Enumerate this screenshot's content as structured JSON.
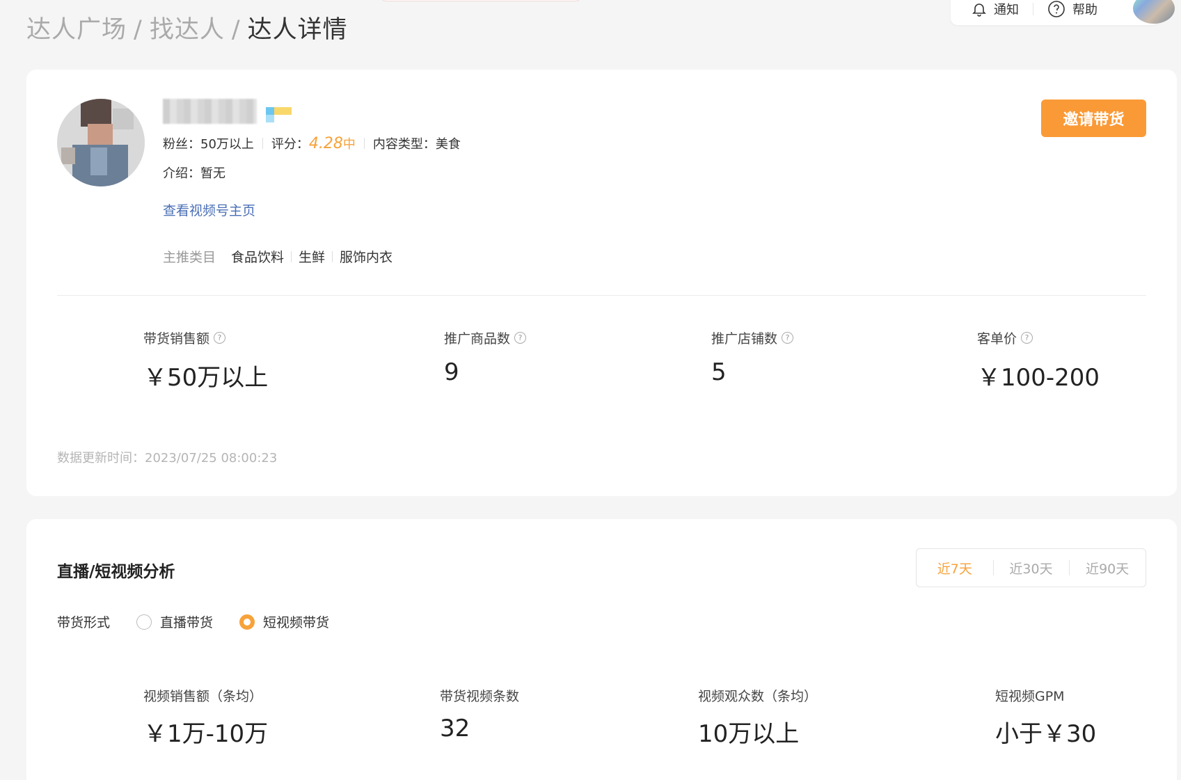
{
  "breadcrumb": {
    "items": [
      "达人广场",
      "找达人"
    ],
    "separator": "/",
    "current": "达人详情"
  },
  "top_tools": {
    "notify_label": "通知",
    "help_label": "帮助"
  },
  "profile": {
    "fans_label": "粉丝：",
    "fans_value": "50万以上",
    "score_label": "评分：",
    "score_value": "4.28",
    "score_level": "中",
    "content_type_label": "内容类型：",
    "content_type_value": "美食",
    "intro_label": "介绍：",
    "intro_value": "暂无",
    "homepage_link": "查看视频号主页",
    "category_label": "主推类目",
    "categories": [
      "食品饮料",
      "生鲜",
      "服饰内衣"
    ],
    "invite_button": "邀请带货"
  },
  "stats": [
    {
      "label": "带货销售额",
      "value": "￥50万以上"
    },
    {
      "label": "推广商品数",
      "value": "9"
    },
    {
      "label": "推广店铺数",
      "value": "5"
    },
    {
      "label": "客单价",
      "value": "￥100-200"
    }
  ],
  "update_time": "数据更新时间：2023/07/25 08:00:23",
  "analysis": {
    "title": "直播/短视频分析",
    "ranges": [
      "近7天",
      "近30天",
      "近90天"
    ],
    "active_range": "近7天",
    "form_label": "带货形式",
    "options": [
      "直播带货",
      "短视频带货"
    ],
    "selected_option": "短视频带货",
    "stats": [
      {
        "label": "视频销售额（条均）",
        "value": "￥1万-10万"
      },
      {
        "label": "带货视频条数",
        "value": "32"
      },
      {
        "label": "视频观众数（条均）",
        "value": "10万以上"
      },
      {
        "label": "短视频GPM",
        "value": "小于￥30"
      }
    ]
  },
  "colors": {
    "accent": "#fa9a37",
    "link": "#4a6fb5",
    "background": "#f5f5f5"
  }
}
